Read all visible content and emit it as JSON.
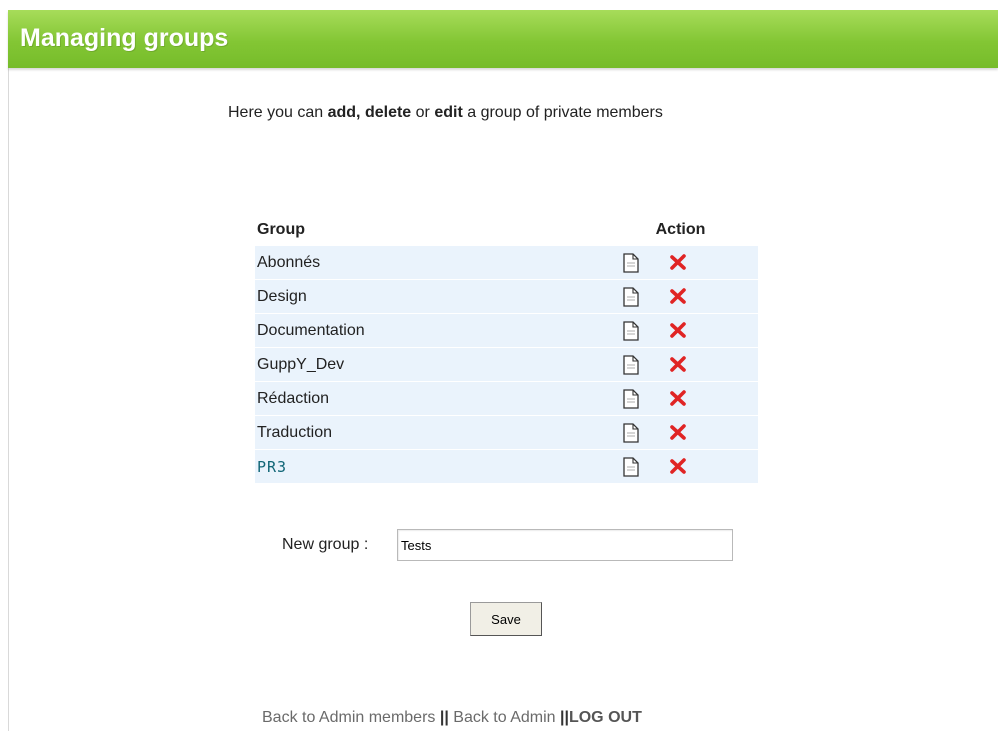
{
  "header": {
    "title": "Managing groups"
  },
  "intro": {
    "before": "Here you can ",
    "add": "add,",
    "space1": " ",
    "delete": "delete",
    "or": " or ",
    "edit": "edit",
    "after": " a group of private members"
  },
  "table": {
    "headers": {
      "group": "Group",
      "action": "Action"
    },
    "rows": [
      {
        "name": "Abonnés"
      },
      {
        "name": "Design"
      },
      {
        "name": "Documentation"
      },
      {
        "name": "GuppY_Dev"
      },
      {
        "name": "Rédaction"
      },
      {
        "name": "Traduction"
      },
      {
        "name": "PR3"
      }
    ]
  },
  "new_group": {
    "label": "New group :",
    "value": "Tests"
  },
  "save_label": "Save",
  "footer": {
    "admin_members": "Back to Admin members",
    "separator": "||",
    "admin": "Back to Admin",
    "logout": "LOG OUT"
  },
  "colors": {
    "header_green": "#83c634",
    "row_bg": "#eaf3fc",
    "delete_red": "#e02424"
  }
}
